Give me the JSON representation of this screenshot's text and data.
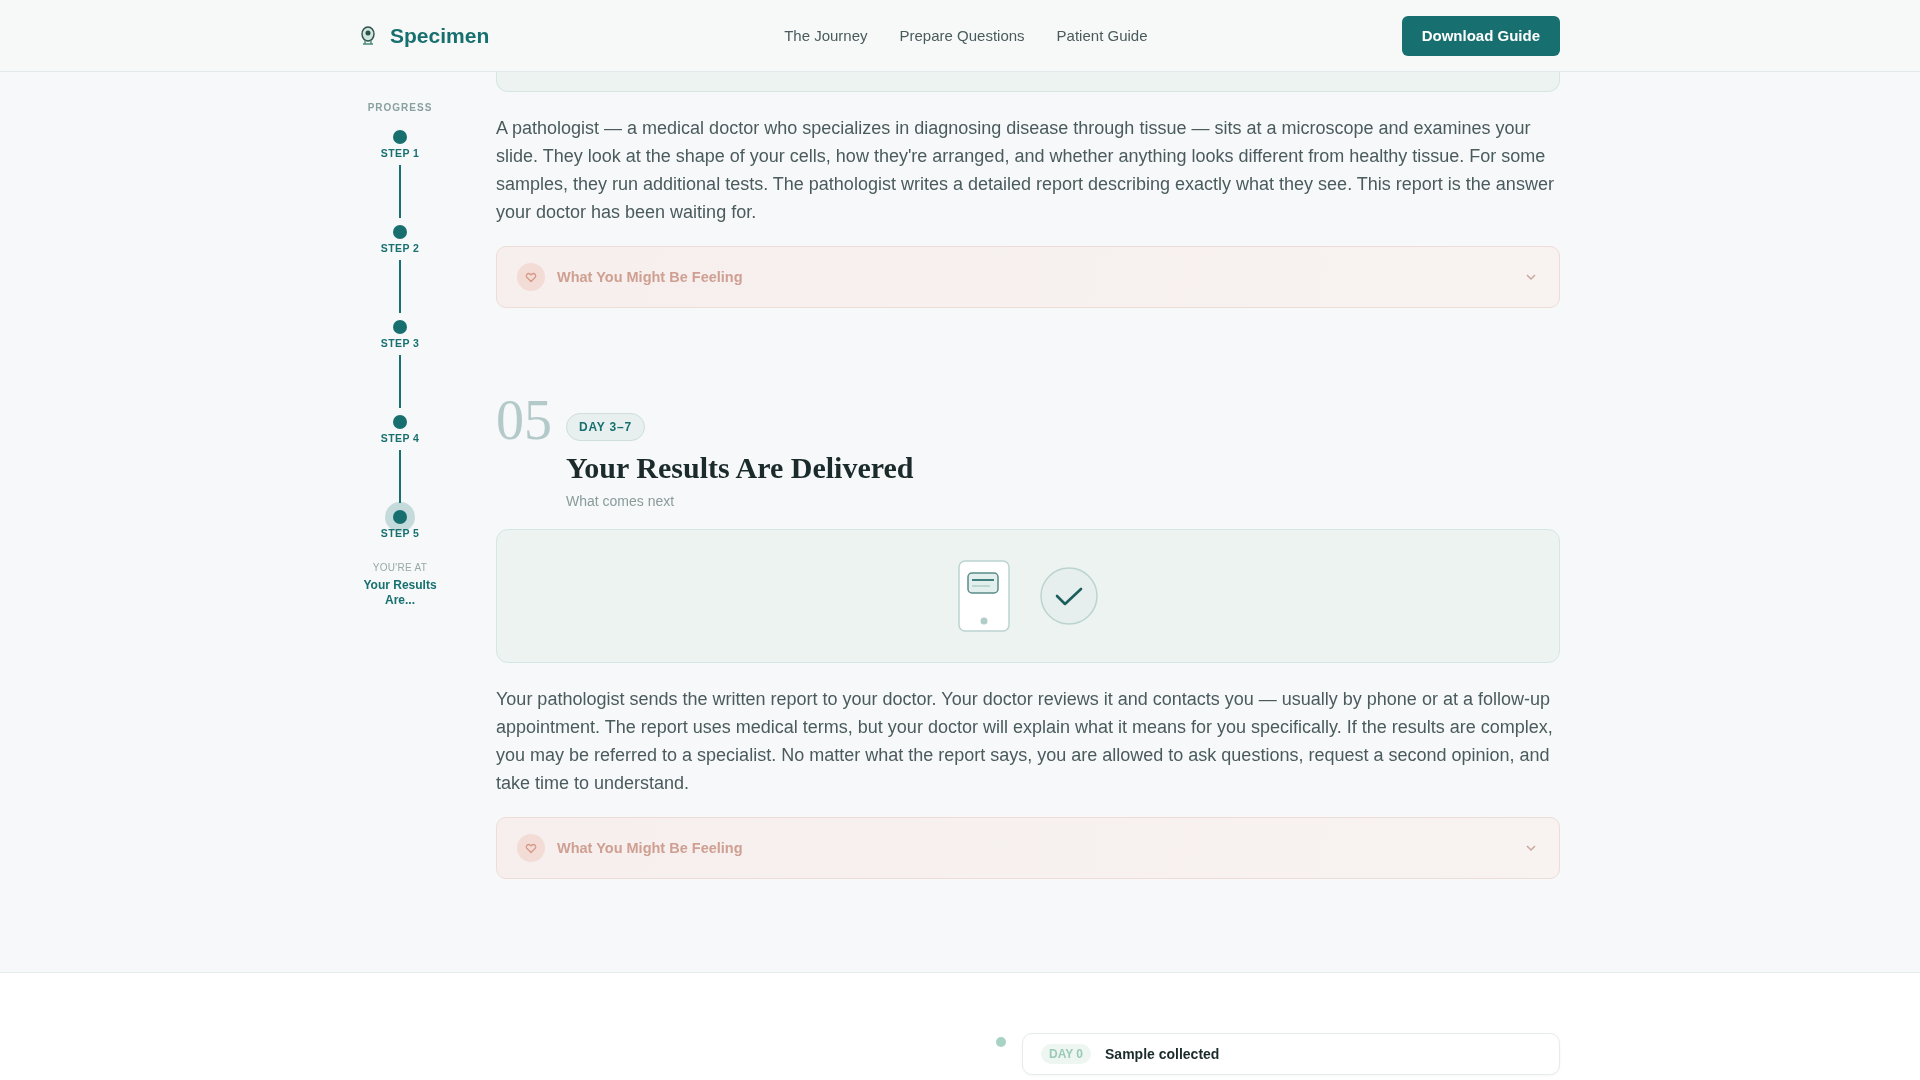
{
  "header": {
    "logo": "Specimen",
    "nav": [
      "The Journey",
      "Prepare Questions",
      "Patient Guide"
    ],
    "button": "Download Guide"
  },
  "sidebar": {
    "heading": "PROGRESS",
    "steps": [
      {
        "label": "STEP 1",
        "selected": false
      },
      {
        "label": "STEP 2",
        "selected": false
      },
      {
        "label": "STEP 3",
        "selected": false
      },
      {
        "label": "STEP 4",
        "selected": false
      },
      {
        "label": "STEP 5",
        "selected": true
      }
    ],
    "current_label": "YOU'RE AT",
    "current_title": "Your Results Are..."
  },
  "sections": [
    {
      "kind": "continued",
      "paragraph": "A pathologist — a medical doctor who specializes in diagnosing disease through tissue — sits at a microscope and examines your slide. They look at the shape of your cells, how they're arranged, and whether anything looks different from healthy tissue. For some samples, they run additional tests. The pathologist writes a detailed report describing exactly what they see. This report is the answer your doctor has been waiting for.",
      "feeling": {
        "label": "What You Might Be Feeling",
        "expanded": false
      }
    },
    {
      "kind": "step",
      "number": "05",
      "day": "DAY 3–7",
      "title": "Your Results Are Delivered",
      "subtitle": "What comes next",
      "paragraph": "Your pathologist sends the written report to your doctor. Your doctor reviews it and contacts you — usually by phone or at a follow-up appointment. The report uses medical terms, but your doctor will explain what it means for you specifically. If the results are complex, you may be referred to a specialist. No matter what the report says, you are allowed to ask questions, request a second opinion, and take time to understand.",
      "feeling": {
        "label": "What You Might Be Feeling",
        "expanded": false
      }
    }
  ],
  "timeline": [
    {
      "day": "DAY 0",
      "title": "Sample collected"
    }
  ]
}
